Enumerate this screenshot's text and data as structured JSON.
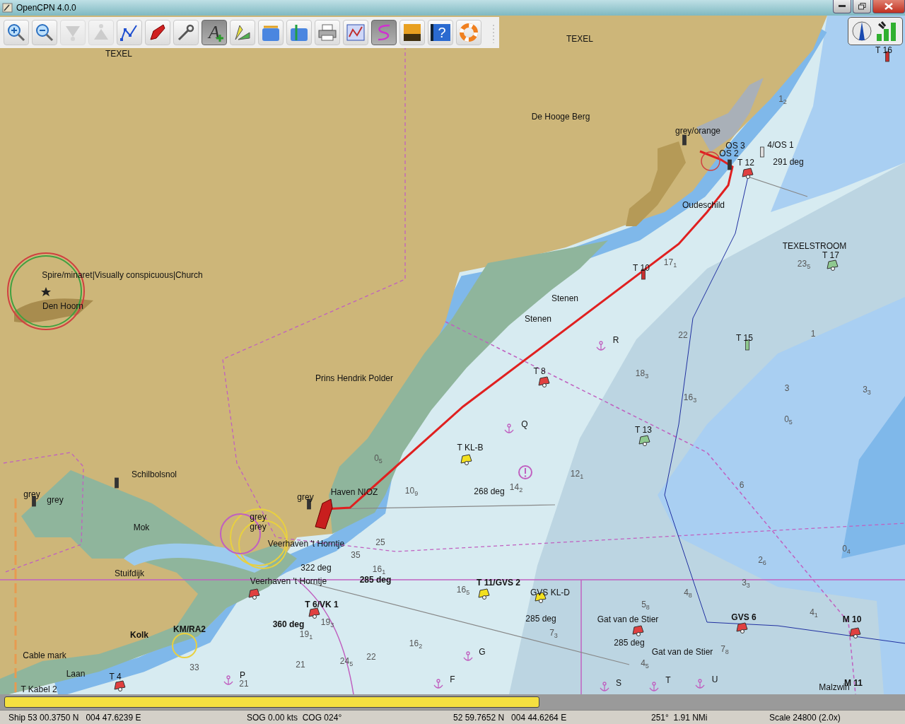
{
  "window": {
    "title": "OpenCPN 4.0.0"
  },
  "toolbar": {
    "buttons": [
      {
        "selected": false,
        "disabled": false
      },
      {
        "selected": false,
        "disabled": false
      },
      {
        "selected": false,
        "disabled": true
      },
      {
        "selected": false,
        "disabled": true
      },
      {
        "selected": false,
        "disabled": false
      },
      {
        "selected": false,
        "disabled": false
      },
      {
        "selected": false,
        "disabled": false
      },
      {
        "selected": true,
        "disabled": false,
        "label": "A"
      },
      {
        "selected": false,
        "disabled": false
      },
      {
        "selected": false,
        "disabled": false
      },
      {
        "selected": false,
        "disabled": false
      },
      {
        "selected": false,
        "disabled": false
      },
      {
        "selected": false,
        "disabled": false
      },
      {
        "selected": true,
        "disabled": false
      },
      {
        "selected": false,
        "disabled": false
      },
      {
        "selected": false,
        "disabled": false,
        "label": "?"
      },
      {
        "selected": false,
        "disabled": false
      }
    ]
  },
  "chart": {
    "labels": [
      {
        "text": "TEXEL",
        "kind": "place"
      },
      {
        "text": "TEXEL",
        "kind": "place"
      },
      {
        "text": "De Hooge Berg",
        "kind": "place"
      },
      {
        "text": "grey/orange",
        "kind": "mark"
      },
      {
        "text": "OS 3",
        "kind": "mark"
      },
      {
        "text": "4/OS 1",
        "kind": "mark"
      },
      {
        "text": "OS 2",
        "kind": "mark"
      },
      {
        "text": "T 12",
        "kind": "mark"
      },
      {
        "text": "291 deg",
        "kind": "mark"
      },
      {
        "text": "T 16",
        "kind": "mark"
      },
      {
        "text": "Oudeschild",
        "kind": "place"
      },
      {
        "text": "TEXELSTROOM",
        "kind": "place"
      },
      {
        "text": "T 17",
        "kind": "mark"
      },
      {
        "text": "T 10",
        "kind": "mark"
      },
      {
        "text": "Spire/minaret|Visually conspicuous|Church",
        "kind": "place"
      },
      {
        "text": "Den Hoorn",
        "kind": "place"
      },
      {
        "text": "Stenen",
        "kind": "mark"
      },
      {
        "text": "Stenen",
        "kind": "mark"
      },
      {
        "text": "R",
        "kind": "mark"
      },
      {
        "text": "T 15",
        "kind": "mark"
      },
      {
        "text": "T 8",
        "kind": "mark"
      },
      {
        "text": "Prins Hendrik Polder",
        "kind": "place"
      },
      {
        "text": "Q",
        "kind": "mark"
      },
      {
        "text": "T 13",
        "kind": "mark"
      },
      {
        "text": "T KL-B",
        "kind": "mark"
      },
      {
        "text": "Schilbolsnol",
        "kind": "place"
      },
      {
        "text": "Haven NIOZ",
        "kind": "place"
      },
      {
        "text": "grey",
        "kind": "mark"
      },
      {
        "text": "268 deg",
        "kind": "mark"
      },
      {
        "text": "grey",
        "kind": "mark"
      },
      {
        "text": "grey",
        "kind": "mark"
      },
      {
        "text": "grey",
        "kind": "mark"
      },
      {
        "text": "grey",
        "kind": "mark"
      },
      {
        "text": "Mok",
        "kind": "place"
      },
      {
        "text": "Veerhaven 't Horntje",
        "kind": "place"
      },
      {
        "text": "Stuifdijk",
        "kind": "place"
      },
      {
        "text": "322 deg",
        "kind": "mark"
      },
      {
        "text": "Veerhaven 't Horntje",
        "kind": "place"
      },
      {
        "text": "285 deg",
        "kind": "bold"
      },
      {
        "text": "T 11/GVS 2",
        "kind": "bold"
      },
      {
        "text": "GVS KL-D",
        "kind": "mark"
      },
      {
        "text": "T 6/VK 1",
        "kind": "bold"
      },
      {
        "text": "285 deg",
        "kind": "mark"
      },
      {
        "text": "Gat van de Stier",
        "kind": "place"
      },
      {
        "text": "GVS 6",
        "kind": "bold"
      },
      {
        "text": "M 10",
        "kind": "bold"
      },
      {
        "text": "360 deg",
        "kind": "bold"
      },
      {
        "text": "KM/RA2",
        "kind": "bold"
      },
      {
        "text": "Kolk",
        "kind": "bold"
      },
      {
        "text": "285 deg",
        "kind": "mark"
      },
      {
        "text": "G",
        "kind": "mark"
      },
      {
        "text": "Gat van de Stier",
        "kind": "place"
      },
      {
        "text": "Cable mark",
        "kind": "place"
      },
      {
        "text": "Laan",
        "kind": "place"
      },
      {
        "text": "T 4",
        "kind": "mark"
      },
      {
        "text": "P",
        "kind": "mark"
      },
      {
        "text": "F",
        "kind": "mark"
      },
      {
        "text": "S",
        "kind": "mark"
      },
      {
        "text": "T",
        "kind": "mark"
      },
      {
        "text": "U",
        "kind": "mark"
      },
      {
        "text": "M 11",
        "kind": "bold"
      },
      {
        "text": "Malzwin",
        "kind": "place"
      },
      {
        "text": "T Kabel 2",
        "kind": "mark"
      }
    ],
    "soundings": [
      {
        "depth": "1",
        "sub": "2"
      },
      {
        "depth": "17",
        "sub": "1"
      },
      {
        "depth": "23",
        "sub": "5"
      },
      {
        "depth": "22"
      },
      {
        "depth": "1"
      },
      {
        "depth": "18",
        "sub": "3"
      },
      {
        "depth": "16",
        "sub": "3"
      },
      {
        "depth": "3"
      },
      {
        "depth": "3",
        "sub": "3"
      },
      {
        "depth": "0",
        "sub": "5"
      },
      {
        "depth": "12",
        "sub": "1"
      },
      {
        "depth": "14",
        "sub": "2"
      },
      {
        "depth": "10",
        "sub": "9"
      },
      {
        "depth": "0",
        "sub": "5"
      },
      {
        "depth": "6"
      },
      {
        "depth": "0",
        "sub": "4"
      },
      {
        "depth": "2",
        "sub": "6"
      },
      {
        "depth": "3",
        "sub": "3"
      },
      {
        "depth": "4",
        "sub": "8"
      },
      {
        "depth": "4",
        "sub": "1"
      },
      {
        "depth": "25"
      },
      {
        "depth": "35"
      },
      {
        "depth": "16",
        "sub": "1"
      },
      {
        "depth": "16",
        "sub": "5"
      },
      {
        "depth": "5",
        "sub": "8"
      },
      {
        "depth": "7",
        "sub": "3"
      },
      {
        "depth": "7",
        "sub": "8"
      },
      {
        "depth": "4",
        "sub": "5"
      },
      {
        "depth": "16",
        "sub": "2"
      },
      {
        "depth": "33"
      },
      {
        "depth": "21"
      },
      {
        "depth": "22"
      },
      {
        "depth": "24",
        "sub": "5"
      },
      {
        "depth": "19",
        "sub": "3"
      },
      {
        "depth": "19",
        "sub": "1"
      },
      {
        "depth": "21"
      }
    ]
  },
  "progress": {
    "level": 0.597
  },
  "status_bar": [
    "Ship 53 00.3750 N   004 47.6239 E",
    "SOG 0.00 kts  COG 024°",
    "52 59.7652 N   004 44.6264 E",
    "251°  1.91 NMi",
    "Scale 24800 (2.0x)"
  ]
}
